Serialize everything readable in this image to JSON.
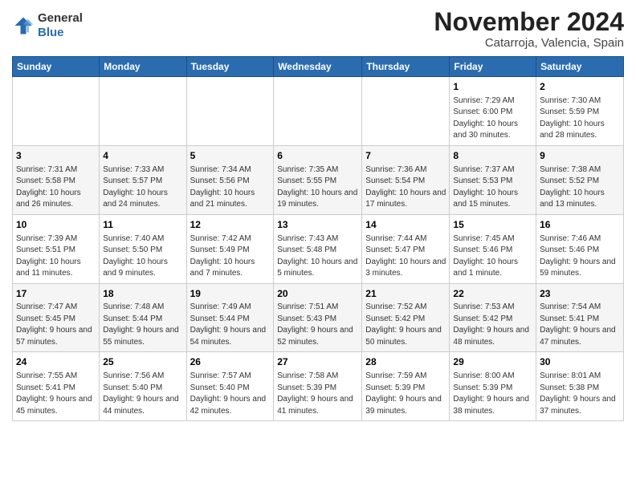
{
  "header": {
    "logo_line1": "General",
    "logo_line2": "Blue",
    "month": "November 2024",
    "location": "Catarroja, Valencia, Spain"
  },
  "weekdays": [
    "Sunday",
    "Monday",
    "Tuesday",
    "Wednesday",
    "Thursday",
    "Friday",
    "Saturday"
  ],
  "weeks": [
    [
      {
        "day": "",
        "info": ""
      },
      {
        "day": "",
        "info": ""
      },
      {
        "day": "",
        "info": ""
      },
      {
        "day": "",
        "info": ""
      },
      {
        "day": "",
        "info": ""
      },
      {
        "day": "1",
        "info": "Sunrise: 7:29 AM\nSunset: 6:00 PM\nDaylight: 10 hours and 30 minutes."
      },
      {
        "day": "2",
        "info": "Sunrise: 7:30 AM\nSunset: 5:59 PM\nDaylight: 10 hours and 28 minutes."
      }
    ],
    [
      {
        "day": "3",
        "info": "Sunrise: 7:31 AM\nSunset: 5:58 PM\nDaylight: 10 hours and 26 minutes."
      },
      {
        "day": "4",
        "info": "Sunrise: 7:33 AM\nSunset: 5:57 PM\nDaylight: 10 hours and 24 minutes."
      },
      {
        "day": "5",
        "info": "Sunrise: 7:34 AM\nSunset: 5:56 PM\nDaylight: 10 hours and 21 minutes."
      },
      {
        "day": "6",
        "info": "Sunrise: 7:35 AM\nSunset: 5:55 PM\nDaylight: 10 hours and 19 minutes."
      },
      {
        "day": "7",
        "info": "Sunrise: 7:36 AM\nSunset: 5:54 PM\nDaylight: 10 hours and 17 minutes."
      },
      {
        "day": "8",
        "info": "Sunrise: 7:37 AM\nSunset: 5:53 PM\nDaylight: 10 hours and 15 minutes."
      },
      {
        "day": "9",
        "info": "Sunrise: 7:38 AM\nSunset: 5:52 PM\nDaylight: 10 hours and 13 minutes."
      }
    ],
    [
      {
        "day": "10",
        "info": "Sunrise: 7:39 AM\nSunset: 5:51 PM\nDaylight: 10 hours and 11 minutes."
      },
      {
        "day": "11",
        "info": "Sunrise: 7:40 AM\nSunset: 5:50 PM\nDaylight: 10 hours and 9 minutes."
      },
      {
        "day": "12",
        "info": "Sunrise: 7:42 AM\nSunset: 5:49 PM\nDaylight: 10 hours and 7 minutes."
      },
      {
        "day": "13",
        "info": "Sunrise: 7:43 AM\nSunset: 5:48 PM\nDaylight: 10 hours and 5 minutes."
      },
      {
        "day": "14",
        "info": "Sunrise: 7:44 AM\nSunset: 5:47 PM\nDaylight: 10 hours and 3 minutes."
      },
      {
        "day": "15",
        "info": "Sunrise: 7:45 AM\nSunset: 5:46 PM\nDaylight: 10 hours and 1 minute."
      },
      {
        "day": "16",
        "info": "Sunrise: 7:46 AM\nSunset: 5:46 PM\nDaylight: 9 hours and 59 minutes."
      }
    ],
    [
      {
        "day": "17",
        "info": "Sunrise: 7:47 AM\nSunset: 5:45 PM\nDaylight: 9 hours and 57 minutes."
      },
      {
        "day": "18",
        "info": "Sunrise: 7:48 AM\nSunset: 5:44 PM\nDaylight: 9 hours and 55 minutes."
      },
      {
        "day": "19",
        "info": "Sunrise: 7:49 AM\nSunset: 5:44 PM\nDaylight: 9 hours and 54 minutes."
      },
      {
        "day": "20",
        "info": "Sunrise: 7:51 AM\nSunset: 5:43 PM\nDaylight: 9 hours and 52 minutes."
      },
      {
        "day": "21",
        "info": "Sunrise: 7:52 AM\nSunset: 5:42 PM\nDaylight: 9 hours and 50 minutes."
      },
      {
        "day": "22",
        "info": "Sunrise: 7:53 AM\nSunset: 5:42 PM\nDaylight: 9 hours and 48 minutes."
      },
      {
        "day": "23",
        "info": "Sunrise: 7:54 AM\nSunset: 5:41 PM\nDaylight: 9 hours and 47 minutes."
      }
    ],
    [
      {
        "day": "24",
        "info": "Sunrise: 7:55 AM\nSunset: 5:41 PM\nDaylight: 9 hours and 45 minutes."
      },
      {
        "day": "25",
        "info": "Sunrise: 7:56 AM\nSunset: 5:40 PM\nDaylight: 9 hours and 44 minutes."
      },
      {
        "day": "26",
        "info": "Sunrise: 7:57 AM\nSunset: 5:40 PM\nDaylight: 9 hours and 42 minutes."
      },
      {
        "day": "27",
        "info": "Sunrise: 7:58 AM\nSunset: 5:39 PM\nDaylight: 9 hours and 41 minutes."
      },
      {
        "day": "28",
        "info": "Sunrise: 7:59 AM\nSunset: 5:39 PM\nDaylight: 9 hours and 39 minutes."
      },
      {
        "day": "29",
        "info": "Sunrise: 8:00 AM\nSunset: 5:39 PM\nDaylight: 9 hours and 38 minutes."
      },
      {
        "day": "30",
        "info": "Sunrise: 8:01 AM\nSunset: 5:38 PM\nDaylight: 9 hours and 37 minutes."
      }
    ]
  ]
}
